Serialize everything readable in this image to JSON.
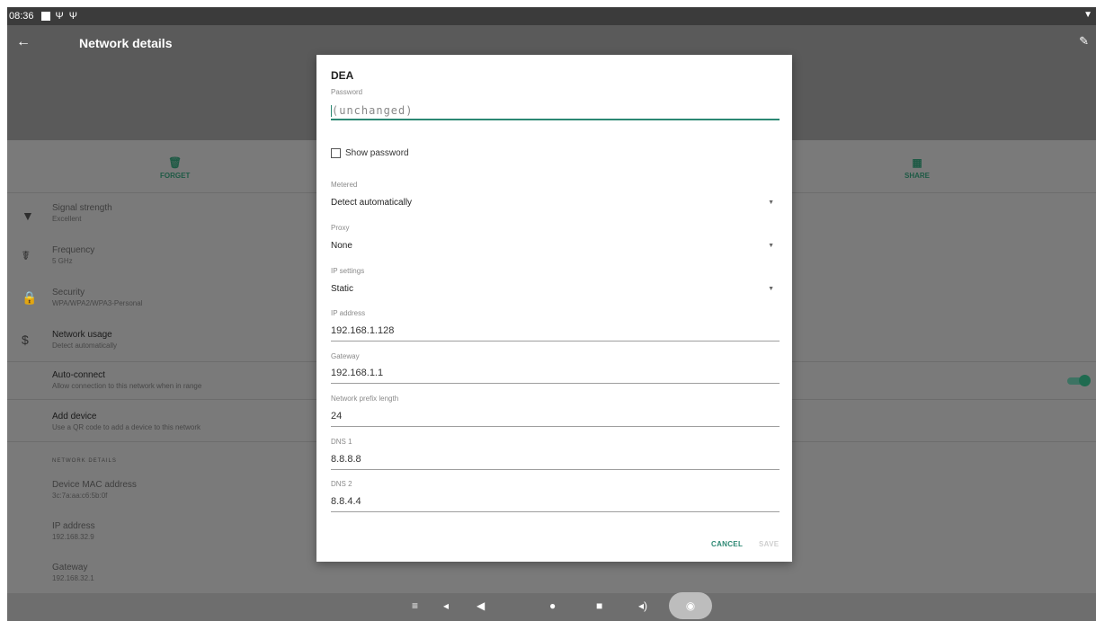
{
  "status_bar": {
    "time": "08:36"
  },
  "app_bar": {
    "title": "Network details"
  },
  "actions": {
    "forget": "FORGET",
    "share": "SHARE"
  },
  "details": [
    {
      "title": "Signal strength",
      "sub": "Excellent"
    },
    {
      "title": "Frequency",
      "sub": "5 GHz"
    },
    {
      "title": "Security",
      "sub": "WPA/WPA2/WPA3-Personal"
    },
    {
      "title": "Network usage",
      "sub": "Detect automatically"
    },
    {
      "title": "Auto-connect",
      "sub": "Allow connection to this network when in range"
    },
    {
      "title": "Add device",
      "sub": "Use a QR code to add a device to this network"
    }
  ],
  "section_title": "NETWORK DETAILS",
  "network_details": [
    {
      "title": "Device MAC address",
      "sub": "3c:7a:aa:c6:5b:0f"
    },
    {
      "title": "IP address",
      "sub": "192.168.32.9"
    },
    {
      "title": "Gateway",
      "sub": "192.168.32.1"
    }
  ],
  "dialog": {
    "title": "DEA",
    "password_label": "Password",
    "password_placeholder": "(unchanged)",
    "show_password": "Show password",
    "metered_label": "Metered",
    "metered_value": "Detect automatically",
    "proxy_label": "Proxy",
    "proxy_value": "None",
    "ip_settings_label": "IP settings",
    "ip_settings_value": "Static",
    "ip_address_label": "IP address",
    "ip_address_value": "192.168.1.128",
    "gateway_label": "Gateway",
    "gateway_value": "192.168.1.1",
    "prefix_label": "Network prefix length",
    "prefix_value": "24",
    "dns1_label": "DNS 1",
    "dns1_value": "8.8.8.8",
    "dns2_label": "DNS 2",
    "dns2_value": "8.8.4.4",
    "cancel": "CANCEL",
    "save": "SAVE"
  },
  "icons": {
    "back": "arrow-back-icon",
    "edit": "pencil-icon",
    "forget": "trash-icon",
    "share": "qr-code-icon",
    "signal": "wifi-signal-icon",
    "frequency": "antenna-icon",
    "security": "lock-icon",
    "usage": "dollar-icon",
    "nav": [
      "collapse-icon",
      "volume-down-icon",
      "back-triangle-icon",
      "home-circle-icon",
      "recents-square-icon",
      "volume-up-icon",
      "camera-icon"
    ]
  },
  "colors": {
    "accent": "#2c8873",
    "toggle_on": "#1f6b50"
  },
  "auto_connect_on": true
}
